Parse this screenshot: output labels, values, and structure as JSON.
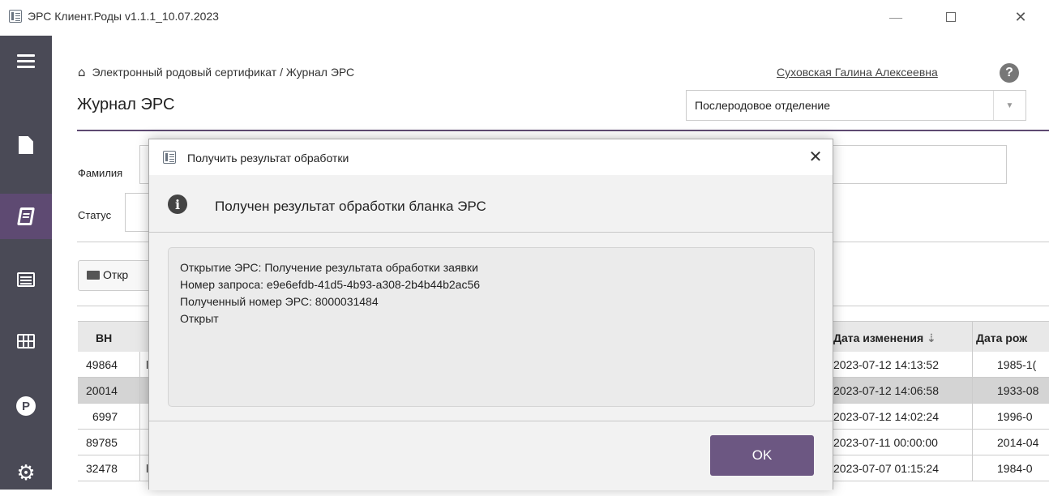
{
  "window": {
    "title": "ЭРС Клиент.Роды v1.1.1_10.07.2023",
    "minimize_glyph": "—",
    "close_glyph": "✕"
  },
  "header": {
    "breadcrumb": "Электронный родовый сертификат / Журнал ЭРС",
    "user_name": "Суховская Галина Алексеевна",
    "help_glyph": "?",
    "page_title": "Журнал ЭРС",
    "department": "Послеродовое отделение",
    "dropdown_glyph": "▼"
  },
  "filters": {
    "surname_label": "Фамилия",
    "status_label": "Статус",
    "open_button_label": "Откр"
  },
  "table": {
    "columns": {
      "vn": "ВН",
      "modified": "Дата изменения",
      "birth": "Дата рож"
    },
    "sort_glyph": "⇣",
    "rows": [
      {
        "vn": "49864",
        "c2": "l",
        "modified": "2023-07-12 14:13:52",
        "birth": "1985-1("
      },
      {
        "vn": "20014",
        "c2": "",
        "modified": "2023-07-12 14:06:58",
        "birth": "1933-08"
      },
      {
        "vn": "6997",
        "c2": "",
        "modified": "2023-07-12 14:02:24",
        "birth": "1996-0"
      },
      {
        "vn": "89785",
        "c2": "",
        "modified": "2023-07-11 00:00:00",
        "birth": "2014-04"
      },
      {
        "vn": "32478",
        "c2": "l",
        "modified": "2023-07-07 01:15:24",
        "birth": "1984-0"
      }
    ]
  },
  "dialog": {
    "title": "Получить результат обработки",
    "close_glyph": "✕",
    "info_glyph": "i",
    "heading": "Получен результат обработки бланка ЭРС",
    "message_lines": [
      "Открытие ЭРС: Получение результата обработки заявки",
      "Номер запроса: e9e6efdb-41d5-4b93-a308-2b4b44b2ac56",
      "Полученный номер ЭРС: 8000031484",
      "Открыт"
    ],
    "ok_label": "OK"
  },
  "sidebar": {
    "p_glyph": "P",
    "gear_glyph": "⚙"
  },
  "colors": {
    "sidebar_bg": "#4a4a56",
    "accent": "#5e4a72",
    "ok_button": "#6c5782"
  }
}
